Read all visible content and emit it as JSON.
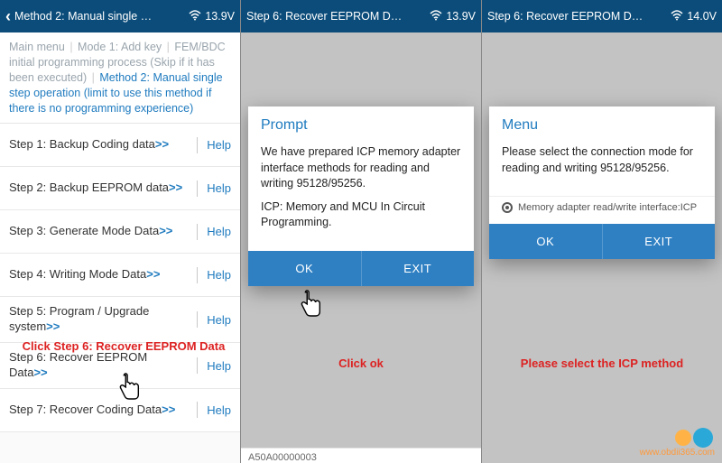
{
  "panels": [
    {
      "header": {
        "title": "Method 2: Manual single …",
        "voltage": "13.9V"
      },
      "breadcrumb": {
        "items": [
          "Main menu",
          "Mode 1: Add key",
          "FEM/BDC initial programming process (Skip if it has been executed)"
        ],
        "active": "Method 2: Manual single step operation (limit to use this method if there is no programming experience)"
      },
      "steps": [
        {
          "label": "Step 1: Backup Coding data",
          "help": "Help"
        },
        {
          "label": "Step 2: Backup EEPROM data",
          "help": "Help"
        },
        {
          "label": "Step 3: Generate Mode Data",
          "help": "Help"
        },
        {
          "label": "Step 4: Writing Mode Data",
          "help": "Help"
        },
        {
          "label": "Step 5: Program / Upgrade system",
          "help": "Help"
        },
        {
          "label": "Step 6: Recover EEPROM Data",
          "help": "Help"
        },
        {
          "label": "Step 7: Recover Coding Data",
          "help": "Help"
        }
      ],
      "annotation": "Click Step 6: Recover EEPROM Data"
    },
    {
      "header": {
        "title": "Step 6: Recover EEPROM D…",
        "voltage": "13.9V"
      },
      "dialog": {
        "title": "Prompt",
        "body1": "We have prepared ICP memory adapter interface methods for reading and writing 95128/95256.",
        "body2": "ICP: Memory and MCU In Circuit Programming.",
        "ok": "OK",
        "exit": "EXIT"
      },
      "serial": "A50A00000003",
      "annotation": "Click ok"
    },
    {
      "header": {
        "title": "Step 6: Recover EEPROM D…",
        "voltage": "14.0V"
      },
      "dialog": {
        "title": "Menu",
        "body1": "Please select the connection mode for reading and writing 95128/95256.",
        "radio": "Memory adapter read/write interface:ICP",
        "ok": "OK",
        "exit": "EXIT"
      },
      "annotation": "Please select the ICP method"
    }
  ],
  "arrows": ">>",
  "divider": "|",
  "watermark": "www.obdii365.com"
}
